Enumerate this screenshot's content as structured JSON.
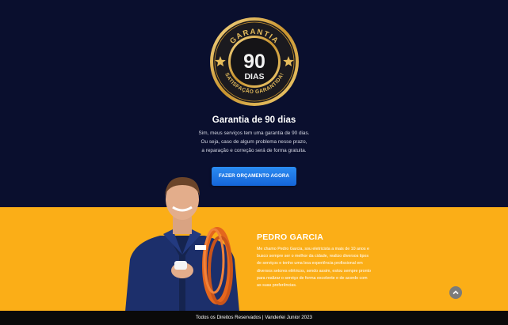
{
  "seal": {
    "top_text": "GARANTIA",
    "number": "90",
    "unit": "DIAS",
    "bottom_text": "SATISFAÇÃO GARANTIDA!"
  },
  "hero": {
    "title": "Garantia de 90 dias",
    "lines": [
      "Sim, meus serviços tem uma garantia de 90 dias.",
      "Ou seja, caso de algum problema nesse prazo,",
      "a reparação e correção será de forma gratuita."
    ],
    "cta_label": "FAZER ORÇAMENTO AGORA"
  },
  "bio": {
    "name": "PEDRO GARCIA",
    "lines": [
      "Me chamo Pedro Garcia, sou eletricista a mais de 10 anos e",
      "busco sempre ser o melhor da cidade, realizo diversos tipos",
      "de serviços e tenho uma boa experiência profissional em",
      "diversos setores elétricos, sendo assim, estou sempre pronto",
      "para realizar o serviço de forma excelente e de acordo com",
      "as suas preferências."
    ]
  },
  "footer": {
    "text": "Todos os Direitos Reservados | Vanderlei Junior 2023"
  },
  "colors": {
    "hero_bg": "#0a0f2e",
    "accent_yellow": "#fbae17",
    "cta_blue": "#1e7be6",
    "gold": "#d9a93a"
  },
  "icons": {
    "scroll_top": "chevron-up-icon",
    "seal_stars": "star-icon"
  }
}
